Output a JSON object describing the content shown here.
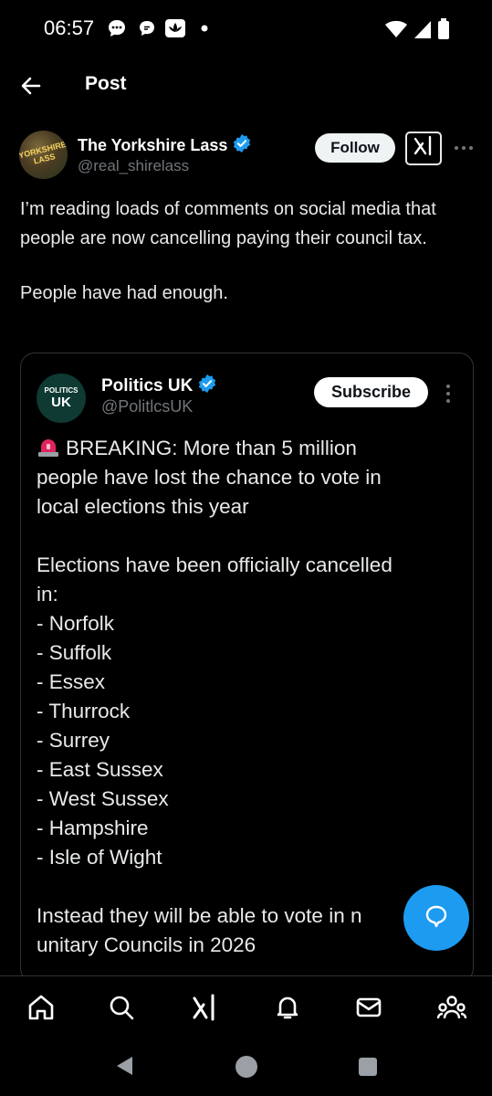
{
  "status_bar": {
    "time": "06:57",
    "notification_icons": [
      "chat-bubble-icon",
      "message-icon",
      "lotus-app-icon"
    ],
    "system_icons": [
      "wifi-icon",
      "cellular-signal-icon",
      "battery-icon"
    ]
  },
  "header": {
    "title": "Post"
  },
  "post": {
    "author_name": "The Yorkshire Lass",
    "author_handle": "@real_shirelass",
    "avatar_text": "YORKSHIRE LASS",
    "follow_label": "Follow",
    "text_paragraph_1": "I’m reading loads of comments on social media that people are now cancelling paying their council tax.",
    "text_paragraph_2": "People have had enough."
  },
  "quoted_post": {
    "author_name": "Politics UK",
    "author_handle": "@PolitlcsUK",
    "avatar_top": "POLITICS",
    "avatar_main": "UK",
    "subscribe_label": "Subscribe",
    "lines": [
      "BREAKING: More than 5 million",
      "people have lost the chance to vote in",
      "local elections this year",
      "",
      "Elections have been officially cancelled",
      "in:",
      "- Norfolk",
      "- Suffolk",
      "- Essex",
      "- Thurrock",
      "- Surrey",
      "- East Sussex",
      "- West Sussex",
      "- Hampshire",
      "- Isle of Wight",
      "",
      "Instead they will be able to vote in n",
      "unitary Councils in 2026"
    ]
  },
  "bottom_nav": [
    "home-icon",
    "search-icon",
    "grok-icon",
    "notifications-icon",
    "messages-icon",
    "communities-icon"
  ],
  "colors": {
    "background": "#000000",
    "accent": "#1d9bf0",
    "text_primary": "#e7e9ea",
    "text_secondary": "#71767b",
    "border": "#2f3336"
  }
}
